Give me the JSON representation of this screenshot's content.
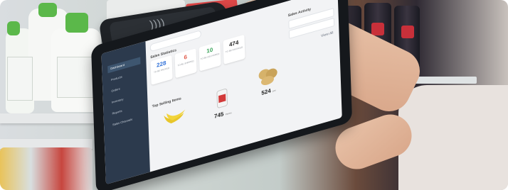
{
  "dashboard": {
    "sales_title": "Sales Statistics",
    "activity_title": "Sales Activity",
    "top_selling_title": "Top Selling Items",
    "view_all": "View All",
    "sidebar_items": [
      "Dashboard",
      "Products",
      "Orders",
      "Inventory",
      "Reports",
      "Sales Channels"
    ],
    "stats": [
      {
        "value": "228",
        "caption": "TO BE PACKED",
        "color": "#2e6fd8"
      },
      {
        "value": "6",
        "caption": "TO BE SHIPPED",
        "color": "#e05a4a"
      },
      {
        "value": "10",
        "caption": "TO BE DELIVERED",
        "color": "#3aa35a"
      },
      {
        "value": "474",
        "caption": "TO BE INVOICED",
        "color": "#222222"
      }
    ],
    "products": [
      {
        "name": "banana",
        "price": "",
        "unit": ""
      },
      {
        "name": "canned drink",
        "price": "745",
        "unit": "Pieces"
      },
      {
        "name": "potatoes",
        "price": "524",
        "unit": "pcs"
      }
    ]
  }
}
